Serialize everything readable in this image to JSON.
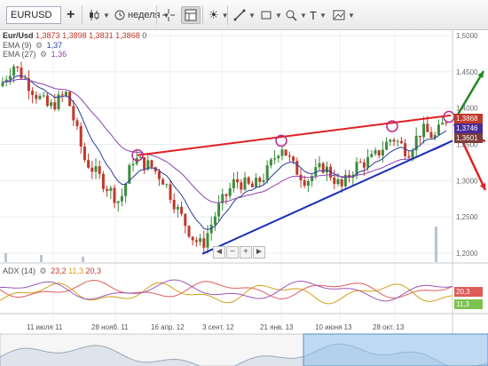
{
  "toolbar": {
    "symbol": "EURUSD",
    "period_label": "неделя",
    "text_tool": "T"
  },
  "legend": {
    "pair": "Eur/Usd",
    "open": "1,3873",
    "high": "1,3898",
    "low": "1,3831",
    "close": "1,3868",
    "zero": "0",
    "ema9_label": "EMA (9)",
    "ema9_value": "1,37",
    "ema27_label": "EMA (27)",
    "ema27_value": "1,36"
  },
  "adx": {
    "label": "ADX (14)",
    "v1": "23,2",
    "v2": "11,3",
    "v3": "20,3",
    "tag_top": "20,3",
    "tag_bottom": "11,3",
    "colors": {
      "adx": "#e05b5b",
      "plus_di": "#d4a017",
      "minus_di": "#9b59b6"
    }
  },
  "price_axis": [
    "1,5000",
    "1,4500",
    "1,4000",
    "1,3500",
    "1,3000",
    "1,2500",
    "1,2000"
  ],
  "price_tags": [
    "1,3868",
    "1,3746",
    "1,3601",
    "1,3500"
  ],
  "time_axis": [
    "11 июля 11",
    "28 нояб. 11",
    "16 апр. 12",
    "3 сент. 12",
    "21 янв. 13",
    "10 июня 13",
    "28 окт. 13"
  ],
  "nav": {
    "prev": "◄",
    "minus": "−",
    "plus": "+",
    "next": "►"
  },
  "colors": {
    "resistance_line": "#e02020",
    "support_line": "#1a2fb8",
    "up_arrow": "#1e8c1e",
    "down_arrow": "#e02020",
    "circle_marker": "#c0298a",
    "candle_up": "#3c8c3c",
    "candle_down": "#c0392b",
    "ema9": "#2c3e9c",
    "ema27": "#8e44ad"
  }
}
